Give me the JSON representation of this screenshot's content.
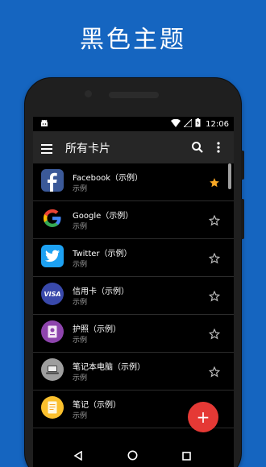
{
  "promo": {
    "title": "黑色主题"
  },
  "status_bar": {
    "time": "12:06"
  },
  "toolbar": {
    "title": "所有卡片",
    "menu_icon": "menu-icon",
    "search_icon": "search-icon",
    "more_icon": "more-vert-icon"
  },
  "cards": [
    {
      "name": "Facebook（示例）",
      "subtitle": "示例",
      "icon": "facebook-icon",
      "color": "#3b5998",
      "starred": true
    },
    {
      "name": "Google（示例）",
      "subtitle": "示例",
      "icon": "google-icon",
      "color": "#ffffff",
      "starred": false
    },
    {
      "name": "Twitter（示例）",
      "subtitle": "示例",
      "icon": "twitter-icon",
      "color": "#1da1f2",
      "starred": false
    },
    {
      "name": "信用卡（示例）",
      "subtitle": "示例",
      "icon": "visa-icon",
      "color": "#3949ab",
      "starred": false
    },
    {
      "name": "护照（示例）",
      "subtitle": "示例",
      "icon": "passport-icon",
      "color": "#8e44ad",
      "starred": false
    },
    {
      "name": "笔记本电脑（示例）",
      "subtitle": "示例",
      "icon": "laptop-icon",
      "color": "#9e9e9e",
      "starred": false
    },
    {
      "name": "笔记（示例）",
      "subtitle": "示例",
      "icon": "note-icon",
      "color": "#fbc02d",
      "starred": false
    }
  ],
  "fab": {
    "label": "+",
    "icon": "add-icon",
    "color": "#e53935"
  },
  "star_color": "#f9a825",
  "visa_text": "VISA"
}
